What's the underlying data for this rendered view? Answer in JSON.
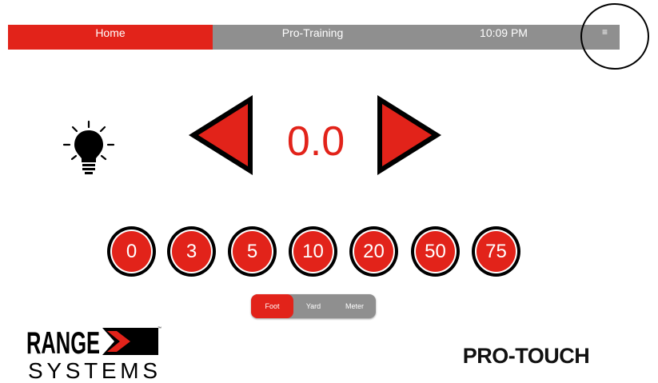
{
  "nav": {
    "home_label": "Home",
    "protraining_label": "Pro-Training",
    "time": "10:09 PM",
    "menu_glyph": "≡"
  },
  "target": {
    "distance": "0.0",
    "left_arrow_icon": "triangle-left-icon",
    "right_arrow_icon": "triangle-right-icon",
    "light_icon": "lightbulb-icon"
  },
  "presets": [
    "0",
    "3",
    "5",
    "10",
    "20",
    "50",
    "75"
  ],
  "units": {
    "options": [
      "Foot",
      "Yard",
      "Meter"
    ],
    "selected": "Foot"
  },
  "branding": {
    "logo_top": "RANGE",
    "logo_bottom": "SYSTEMS",
    "logo_tm": "™",
    "product": "PRO-TOUCH"
  },
  "colors": {
    "accent": "#e2231a",
    "bar_gray": "#8f8f8f",
    "text_dark": "#111111"
  }
}
